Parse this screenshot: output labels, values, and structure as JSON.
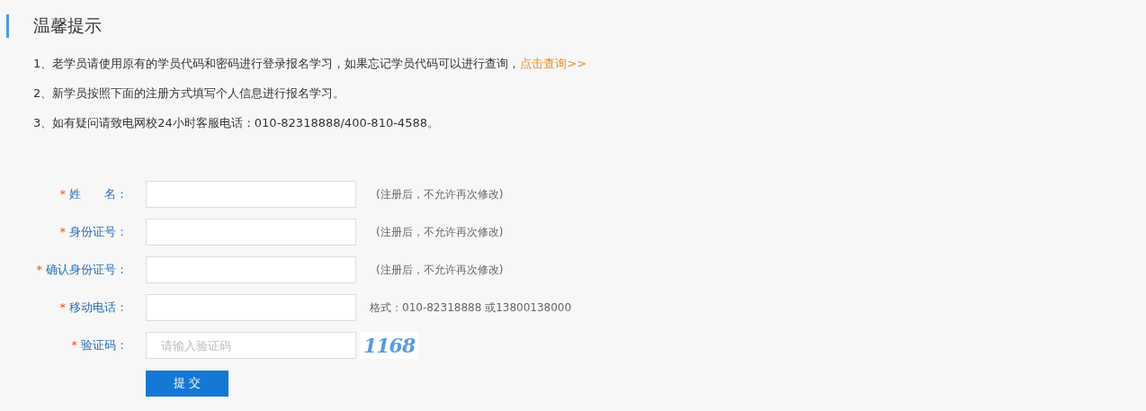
{
  "title": "温馨提示",
  "notes": [
    {
      "text": "1、老学员请使用原有的学员代码和密码进行登录报名学习，如果忘记学员代码可以进行查询，",
      "link": "点击查询>>"
    },
    {
      "text": "2、新学员按照下面的注册方式填写个人信息进行报名学习。"
    },
    {
      "text": "3、如有疑问请致电网校24小时客服电话：010-82318888/400-810-4588。"
    }
  ],
  "fields": [
    {
      "mark": "*",
      "label": "姓　　名：",
      "kind": "text",
      "hint": "(注册后，不允许再次修改)"
    },
    {
      "mark": "*",
      "label": "身份证号：",
      "kind": "text",
      "hint": "(注册后，不允许再次修改)"
    },
    {
      "mark": "*",
      "label": "确认身份证号：",
      "kind": "text",
      "hint": "(注册后，不允许再次修改)"
    },
    {
      "mark": "*",
      "label": "移动电话：",
      "kind": "text",
      "hint": "格式：010-82318888 或13800138000"
    },
    {
      "mark": "*",
      "label": "验证码：",
      "kind": "captcha",
      "placeholder": "请输入验证码",
      "captcha": "1168"
    }
  ],
  "submit": "提 交"
}
